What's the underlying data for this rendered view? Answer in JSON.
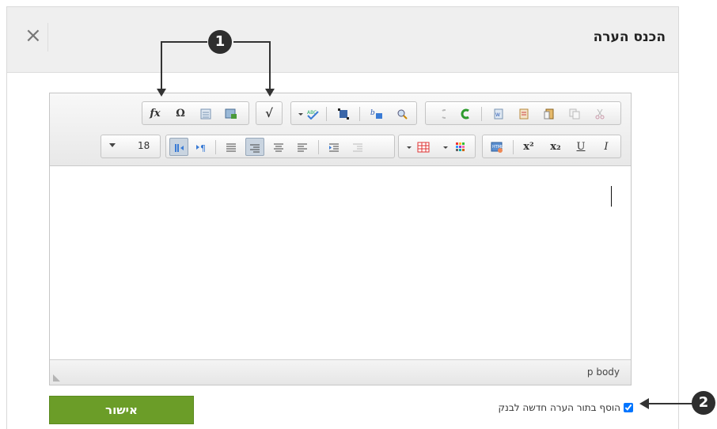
{
  "dialog": {
    "title": "הכנס הערה",
    "close_glyph": "×"
  },
  "toolbar": {
    "row1": {
      "fx": "fx",
      "omega": "Ω",
      "sqrt": "√"
    },
    "row2": {
      "font_size": "18",
      "superscript": "x²",
      "subscript": "x₂",
      "underline": "U",
      "italic": "I"
    }
  },
  "statusbar": {
    "path": "p  body"
  },
  "footer": {
    "ok_label": "אישור",
    "add_to_bank_label": "הוסף בתור הערה חדשה לבנק",
    "add_to_bank_checked": true
  },
  "annotations": {
    "badge1": "1",
    "badge2": "2"
  },
  "colors": {
    "accent_green": "#6b9d28",
    "badge": "#2e2e2e"
  }
}
